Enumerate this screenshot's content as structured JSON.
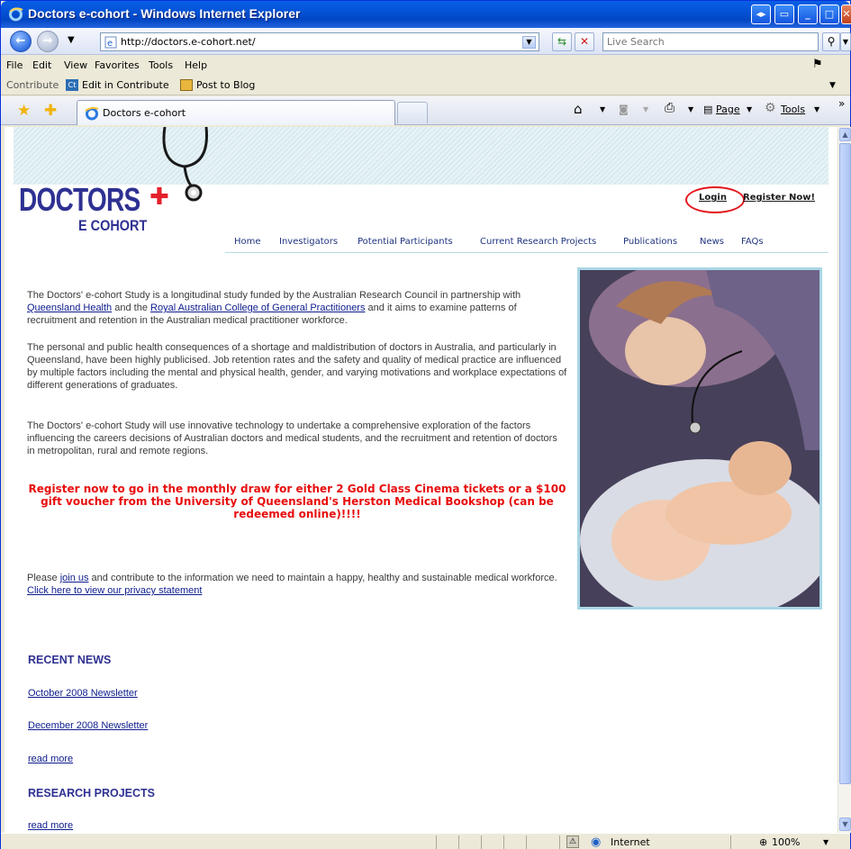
{
  "window": {
    "title": "Doctors e-cohort - Windows Internet Explorer"
  },
  "address": {
    "url": "http://doctors.e-cohort.net/"
  },
  "search": {
    "placeholder": "Live Search"
  },
  "menu": {
    "items": [
      "File",
      "Edit",
      "View",
      "Favorites",
      "Tools",
      "Help"
    ]
  },
  "contribute_bar": {
    "label": "Contribute",
    "edit_label": "Edit in Contribute",
    "post_label": "Post to Blog"
  },
  "tab": {
    "title": "Doctors e-cohort"
  },
  "command_bar": {
    "page_label": "Page",
    "tools_label": "Tools"
  },
  "status": {
    "zone": "Internet",
    "zoom": "100%"
  },
  "page": {
    "logo": {
      "main": "DOCTORS",
      "sub": "E COHORT"
    },
    "top_links": {
      "login": "Login",
      "register": "Register Now!"
    },
    "nav": [
      "Home",
      "Investigators",
      "Potential Participants",
      "Current Research Projects",
      "Publications",
      "News",
      "FAQs"
    ],
    "para1": {
      "text1": "The Doctors' e-cohort Study is a longitudinal study funded by the Australian Research Council in partnership with ",
      "link1": "Queensland Health",
      "text2": " and the ",
      "link2": "Royal Australian College of General Practitioners",
      "text3": " and it aims to examine patterns of recruitment and retention in the Australian medical practitioner workforce."
    },
    "para2": "The personal and public health consequences of a shortage and maldistribution of doctors in Australia, and particularly in Queensland, have been highly publicised. Job retention rates and the safety and quality of medical practice are influenced by multiple factors including the mental and physical health, gender, and varying motivations and workplace expectations of different generations of graduates.",
    "para3": "The Doctors' e-cohort Study will use innovative technology to undertake a comprehensive exploration of the factors influencing the careers decisions of Australian doctors and medical students, and the recruitment and retention of doctors in metropolitan, rural and remote regions.",
    "promo": "Register now to go in the monthly draw for either 2 Gold Class Cinema tickets or a $100 gift voucher from the University of Queensland's Herston Medical Bookshop (can be redeemed online)!!!!",
    "join": {
      "text1": "Please ",
      "link1": "join us",
      "text2": " and contribute to the information we need to maintain a happy, healthy and sustainable medical workforce. ",
      "link2": "Click here to view our privacy statement"
    },
    "recent_news": {
      "heading": "RECENT NEWS",
      "items": [
        "October 2008 Newsletter",
        "December 2008 Newsletter"
      ],
      "more": "read more"
    },
    "research": {
      "heading": "RESEARCH PROJECTS",
      "more": "read more"
    }
  }
}
